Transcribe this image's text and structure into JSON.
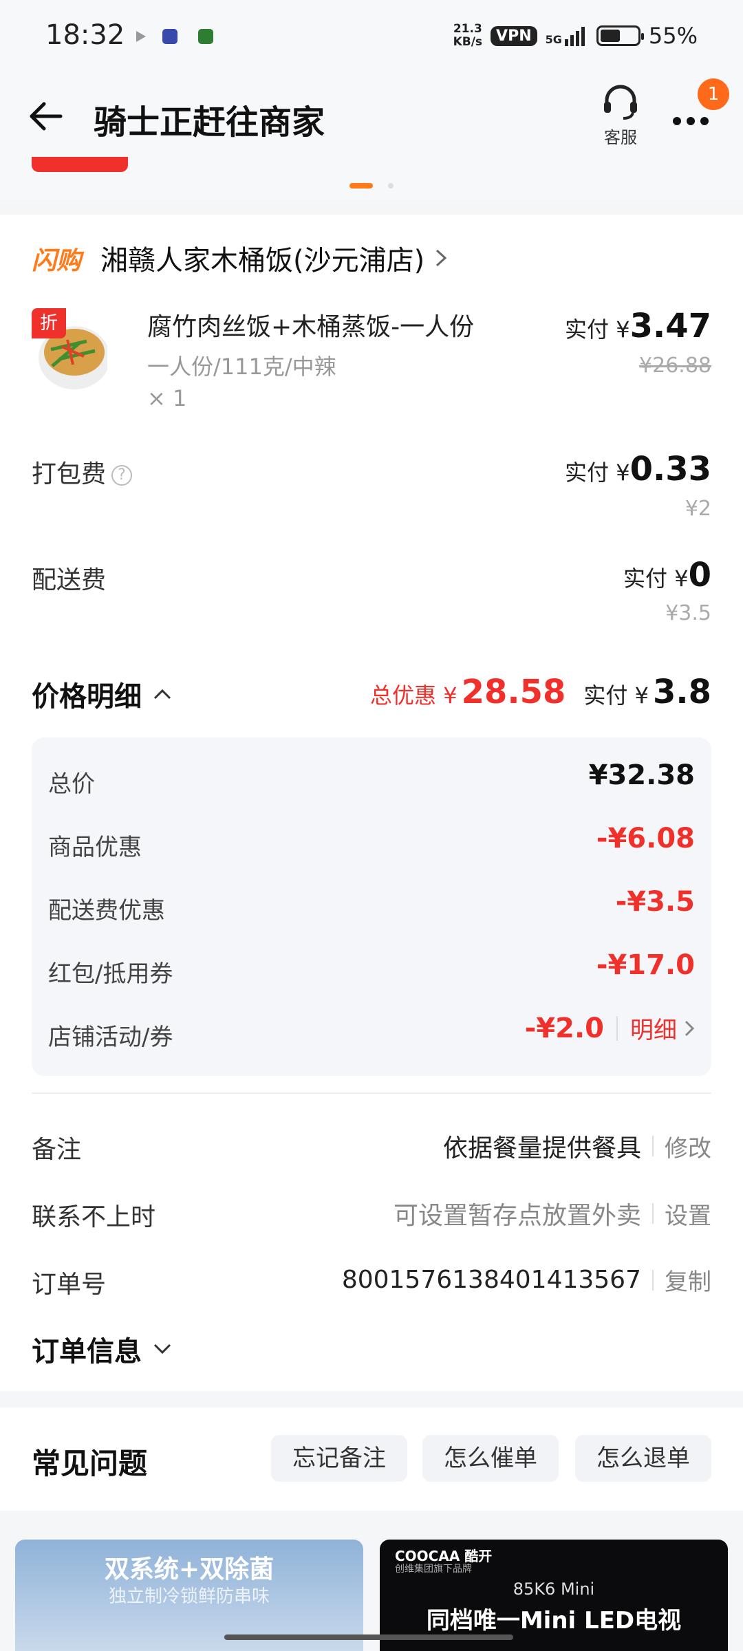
{
  "status": {
    "time": "18:32",
    "net_speed_value": "21.3",
    "net_speed_unit": "KB/s",
    "vpn": "VPN",
    "signal": "5G",
    "battery": "55%",
    "battery_level": 0.55
  },
  "header": {
    "title": "骑士正赶往商家",
    "service_label": "客服",
    "badge": "1"
  },
  "shop": {
    "tag": "闪购",
    "name": "湘赣人家木桶饭(沙元浦店)"
  },
  "item": {
    "discount_tag": "折",
    "name": "腐竹肉丝饭+木桶蒸饭-一人份",
    "spec": "一人份/111克/中辣",
    "qty": "× 1",
    "pay_label": "实付 ¥",
    "pay_value": "3.47",
    "orig_price": "¥26.88"
  },
  "packing": {
    "label": "打包费",
    "help": "?",
    "pay_label": "实付 ¥",
    "pay_value": "0.33",
    "orig_price": "¥2"
  },
  "delivery": {
    "label": "配送费",
    "pay_label": "实付 ¥",
    "pay_value": "0",
    "orig_price": "¥3.5"
  },
  "price_detail": {
    "title": "价格明细",
    "discount_label": "总优惠 ¥",
    "discount_value": "28.58",
    "pay_label": "实付 ¥",
    "pay_value": "3.8",
    "rows": [
      {
        "label": "总价",
        "value": "¥32.38"
      },
      {
        "label": "商品优惠",
        "value": "-¥6.08"
      },
      {
        "label": "配送费优惠",
        "value": "-¥3.5"
      },
      {
        "label": "红包/抵用券",
        "value": "-¥17.0"
      },
      {
        "label": "店铺活动/券",
        "value": "-¥2.0"
      }
    ],
    "detail_link": "明细"
  },
  "order": {
    "remark_label": "备注",
    "remark_value": "依据餐量提供餐具",
    "remark_action": "修改",
    "contact_label": "联系不上时",
    "contact_value": "可设置暂存点放置外卖",
    "contact_action": "设置",
    "no_label": "订单号",
    "no_value": "8001576138401413567",
    "no_action": "复制",
    "info_title": "订单信息"
  },
  "faq": {
    "title": "常见问题",
    "buttons": [
      "忘记备注",
      "怎么催单",
      "怎么退单"
    ]
  },
  "ads": {
    "ad1_title": "双系统+双除菌",
    "ad1_sub": "独立制冷锁鲜防串味",
    "ad2_brand": "COOCAA 酷开",
    "ad2_sub": "创维集团旗下品牌",
    "ad2_model": "85K6 Mini",
    "ad2_title": "同档唯一Mini LED电视"
  },
  "colors": {
    "accent": "#ff7a18",
    "discount_red": "#f0302b"
  }
}
